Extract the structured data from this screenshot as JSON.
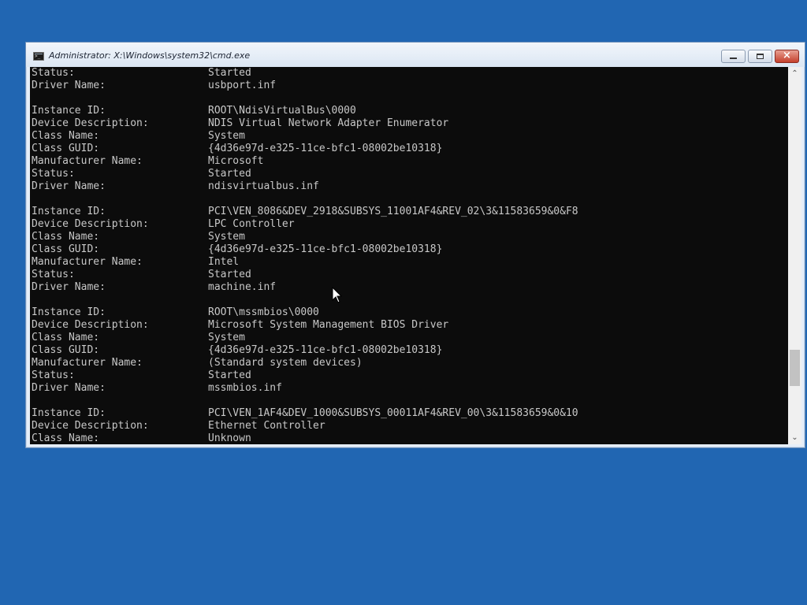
{
  "window": {
    "title": "Administrator: X:\\Windows\\system32\\cmd.exe",
    "icon": "cmd-icon",
    "controls": [
      "minimize-icon",
      "maximize-icon",
      "close-icon"
    ]
  },
  "colors": {
    "desktop": "#2166b2",
    "console_bg": "#0c0c0c",
    "console_fg": "#c8c8c8",
    "close_button": "#c5402c"
  },
  "console": {
    "lines": [
      {
        "k": "Status:",
        "v": "Started"
      },
      {
        "k": "Driver Name:",
        "v": "usbport.inf"
      },
      {
        "k": "",
        "v": ""
      },
      {
        "k": "Instance ID:",
        "v": "ROOT\\NdisVirtualBus\\0000"
      },
      {
        "k": "Device Description:",
        "v": "NDIS Virtual Network Adapter Enumerator"
      },
      {
        "k": "Class Name:",
        "v": "System"
      },
      {
        "k": "Class GUID:",
        "v": "{4d36e97d-e325-11ce-bfc1-08002be10318}"
      },
      {
        "k": "Manufacturer Name:",
        "v": "Microsoft"
      },
      {
        "k": "Status:",
        "v": "Started"
      },
      {
        "k": "Driver Name:",
        "v": "ndisvirtualbus.inf"
      },
      {
        "k": "",
        "v": ""
      },
      {
        "k": "Instance ID:",
        "v": "PCI\\VEN_8086&DEV_2918&SUBSYS_11001AF4&REV_02\\3&11583659&0&F8"
      },
      {
        "k": "Device Description:",
        "v": "LPC Controller"
      },
      {
        "k": "Class Name:",
        "v": "System"
      },
      {
        "k": "Class GUID:",
        "v": "{4d36e97d-e325-11ce-bfc1-08002be10318}"
      },
      {
        "k": "Manufacturer Name:",
        "v": "Intel"
      },
      {
        "k": "Status:",
        "v": "Started"
      },
      {
        "k": "Driver Name:",
        "v": "machine.inf"
      },
      {
        "k": "",
        "v": ""
      },
      {
        "k": "Instance ID:",
        "v": "ROOT\\mssmbios\\0000"
      },
      {
        "k": "Device Description:",
        "v": "Microsoft System Management BIOS Driver"
      },
      {
        "k": "Class Name:",
        "v": "System"
      },
      {
        "k": "Class GUID:",
        "v": "{4d36e97d-e325-11ce-bfc1-08002be10318}"
      },
      {
        "k": "Manufacturer Name:",
        "v": "(Standard system devices)"
      },
      {
        "k": "Status:",
        "v": "Started"
      },
      {
        "k": "Driver Name:",
        "v": "mssmbios.inf"
      },
      {
        "k": "",
        "v": ""
      },
      {
        "k": "Instance ID:",
        "v": "PCI\\VEN_1AF4&DEV_1000&SUBSYS_00011AF4&REV_00\\3&11583659&0&10"
      },
      {
        "k": "Device Description:",
        "v": "Ethernet Controller"
      },
      {
        "k": "Class Name:",
        "v": "Unknown"
      }
    ]
  },
  "scrollbar": {
    "up_glyph": "⌃",
    "down_glyph": "⌄"
  }
}
